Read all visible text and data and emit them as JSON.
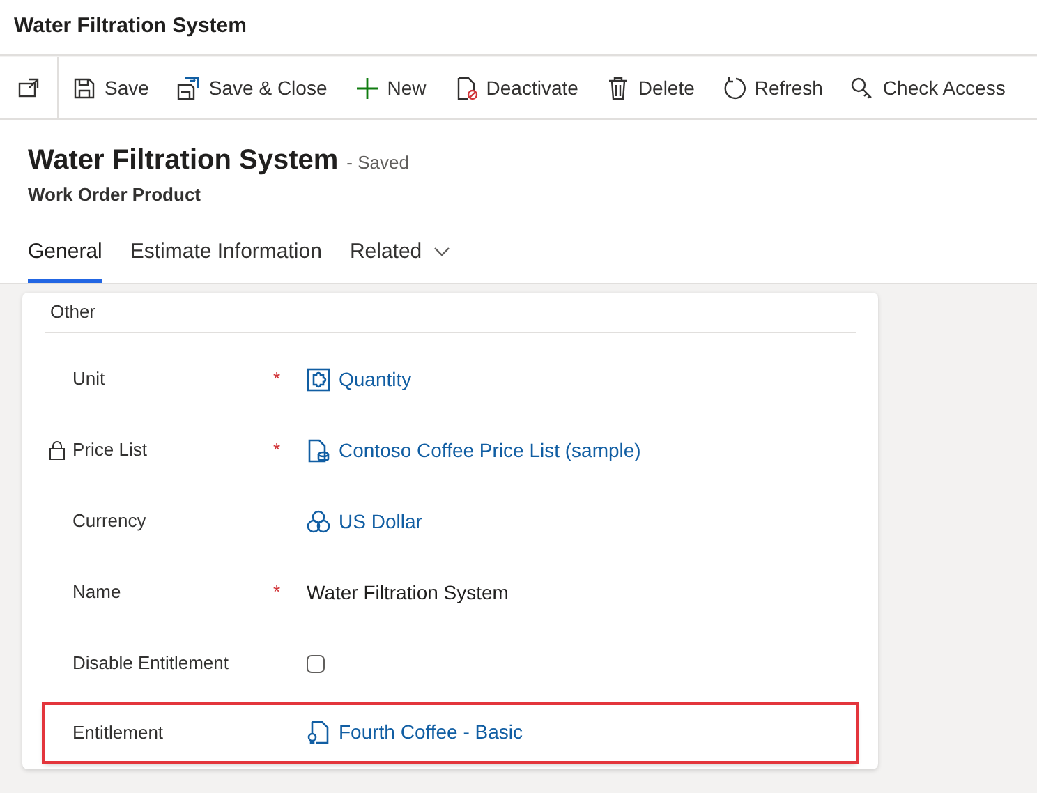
{
  "window": {
    "title": "Water Filtration System"
  },
  "toolbar": [
    {
      "kind": "popout"
    },
    {
      "kind": "save",
      "label": "Save"
    },
    {
      "kind": "saveclose",
      "label": "Save & Close"
    },
    {
      "kind": "new",
      "label": "New"
    },
    {
      "kind": "deactivate",
      "label": "Deactivate"
    },
    {
      "kind": "delete",
      "label": "Delete"
    },
    {
      "kind": "refresh",
      "label": "Refresh"
    },
    {
      "kind": "access",
      "label": "Check Access"
    }
  ],
  "record": {
    "title": "Water Filtration System",
    "status": "- Saved",
    "entity": "Work Order Product"
  },
  "tabs": [
    {
      "label": "General",
      "selected": true
    },
    {
      "label": "Estimate Information",
      "selected": false
    },
    {
      "label": "Related",
      "selected": false,
      "dropdown": true
    }
  ],
  "section": {
    "title": "Other"
  },
  "fields": [
    {
      "label": "Unit",
      "kind": "unit",
      "value": "Quantity",
      "required_mark": "*"
    },
    {
      "label": "Price List",
      "kind": "pricelist",
      "value": "Contoso Coffee Price List (sample)",
      "required_mark": "*",
      "locked": true
    },
    {
      "label": "Currency",
      "kind": "currency",
      "value": "US Dollar"
    },
    {
      "label": "Name",
      "kind": "text",
      "value": "Water Filtration System",
      "required_mark": "*"
    },
    {
      "label": "Disable Entitlement",
      "kind": "checkbox",
      "checked": false
    },
    {
      "label": "Entitlement",
      "kind": "entitlement",
      "value": "Fourth Coffee - Basic",
      "highlighted": true
    }
  ]
}
